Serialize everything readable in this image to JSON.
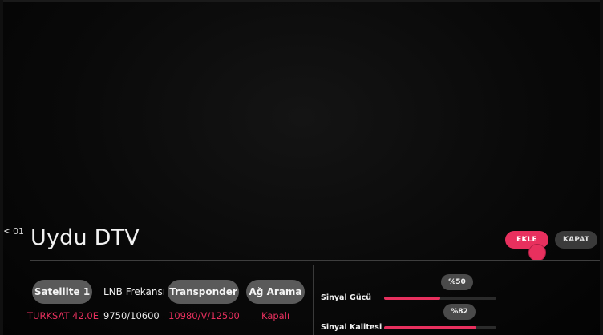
{
  "nav": {
    "back_chevron": "<",
    "back_number": "01"
  },
  "header": {
    "title": "Uydu DTV"
  },
  "actions": {
    "add_label": "EKLE",
    "close_label": "KAPAT"
  },
  "params": {
    "satellite": {
      "button_label": "Satellite 1",
      "value": "TURKSAT 42.0E"
    },
    "lnb": {
      "label": "LNB Frekansı",
      "value": "9750/10600"
    },
    "transponder": {
      "button_label": "Transponder",
      "value": "10980/V/12500"
    },
    "network_search": {
      "button_label": "Ağ Arama",
      "value": "Kapalı"
    }
  },
  "signal": {
    "strength": {
      "label": "Sinyal Gücü",
      "badge": "%50",
      "level": 50
    },
    "quality": {
      "label": "Sinyal Kalitesi",
      "badge": "%82",
      "level": 82
    }
  },
  "colors": {
    "accent": "#e8305e",
    "button_gray": "#5a5a5a"
  }
}
